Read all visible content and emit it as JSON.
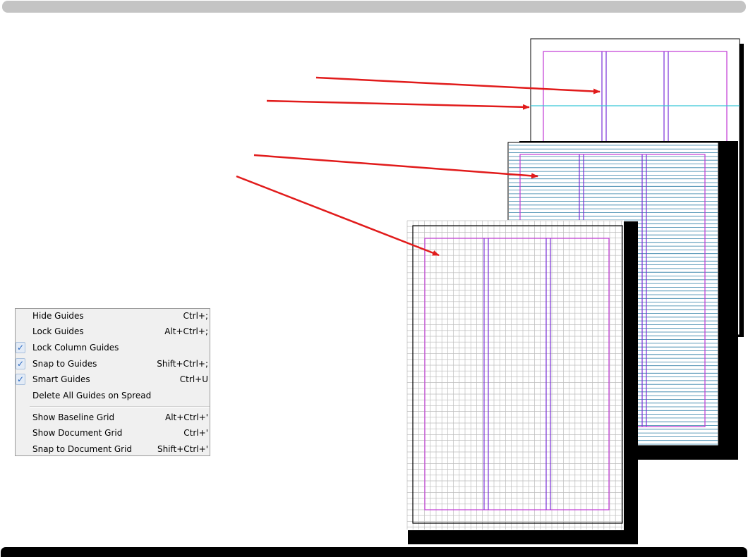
{
  "menu": {
    "items": [
      {
        "label": "Hide Guides",
        "shortcut": "Ctrl+;",
        "checked": false
      },
      {
        "label": "Lock Guides",
        "shortcut": "Alt+Ctrl+;",
        "checked": false
      },
      {
        "label": "Lock Column Guides",
        "shortcut": "",
        "checked": true
      },
      {
        "label": "Snap to Guides",
        "shortcut": "Shift+Ctrl+;",
        "checked": true
      },
      {
        "label": "Smart Guides",
        "shortcut": "Ctrl+U",
        "checked": true
      },
      {
        "label": "Delete All Guides on Spread",
        "shortcut": "",
        "checked": false
      },
      {
        "label": "Show Baseline Grid",
        "shortcut": "Alt+Ctrl+'",
        "checked": false
      },
      {
        "label": "Show Document Grid",
        "shortcut": "Ctrl+'",
        "checked": false
      },
      {
        "label": "Snap to Document Grid",
        "shortcut": "Shift+Ctrl+'",
        "checked": false
      }
    ],
    "check_glyph": "✓"
  },
  "colors": {
    "margin_guide": "#c23ad6",
    "column_guide": "#7a2fd8",
    "ruler_guide": "#37c6d8",
    "baseline_grid": "#2f7fa6",
    "document_grid": "#bdbdbd",
    "arrow": "#e11b1b"
  }
}
